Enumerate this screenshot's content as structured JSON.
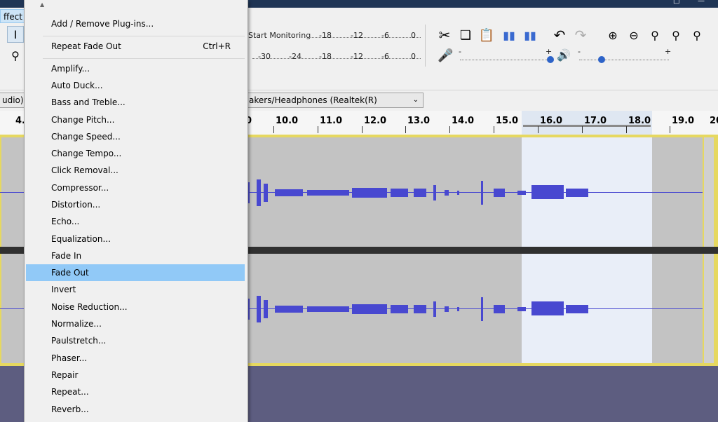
{
  "menubar": {
    "effect_label": "ffect"
  },
  "toolbar": {
    "start_monitoring": "Start Monitoring",
    "record_meter_ticks": [
      "-18",
      "-12",
      "-6",
      "0"
    ],
    "play_meter_ticks": [
      "-30",
      "-24",
      "-18",
      "-12",
      "-6",
      "0"
    ],
    "slider_min": "-",
    "slider_max": "+"
  },
  "device": {
    "host_partial": "udio)",
    "output_device": "akers/Headphones (Realtek(R)"
  },
  "ruler": {
    "labels": [
      "4.",
      "0",
      "10.0",
      "11.0",
      "12.0",
      "13.0",
      "14.0",
      "15.0",
      "16.0",
      "17.0",
      "18.0",
      "19.0",
      "20"
    ]
  },
  "menu": {
    "items": [
      {
        "label": "Add / Remove Plug-ins...",
        "accel": ""
      },
      {
        "label": "Repeat Fade Out",
        "accel": "Ctrl+R"
      },
      {
        "label": "Amplify...",
        "accel": ""
      },
      {
        "label": "Auto Duck...",
        "accel": ""
      },
      {
        "label": "Bass and Treble...",
        "accel": ""
      },
      {
        "label": "Change Pitch...",
        "accel": ""
      },
      {
        "label": "Change Speed...",
        "accel": ""
      },
      {
        "label": "Change Tempo...",
        "accel": ""
      },
      {
        "label": "Click Removal...",
        "accel": ""
      },
      {
        "label": "Compressor...",
        "accel": ""
      },
      {
        "label": "Distortion...",
        "accel": ""
      },
      {
        "label": "Echo...",
        "accel": ""
      },
      {
        "label": "Equalization...",
        "accel": ""
      },
      {
        "label": "Fade In",
        "accel": ""
      },
      {
        "label": "Fade Out",
        "accel": ""
      },
      {
        "label": "Invert",
        "accel": ""
      },
      {
        "label": "Noise Reduction...",
        "accel": ""
      },
      {
        "label": "Normalize...",
        "accel": ""
      },
      {
        "label": "Paulstretch...",
        "accel": ""
      },
      {
        "label": "Phaser...",
        "accel": ""
      },
      {
        "label": "Repair",
        "accel": ""
      },
      {
        "label": "Repeat...",
        "accel": ""
      },
      {
        "label": "Reverb...",
        "accel": ""
      }
    ],
    "highlighted": "Fade Out"
  },
  "colors": {
    "waveform": "#4848d0",
    "selection": "#e9eef8",
    "menu_highlight": "#91c9f7",
    "track_border": "#e6d860"
  }
}
